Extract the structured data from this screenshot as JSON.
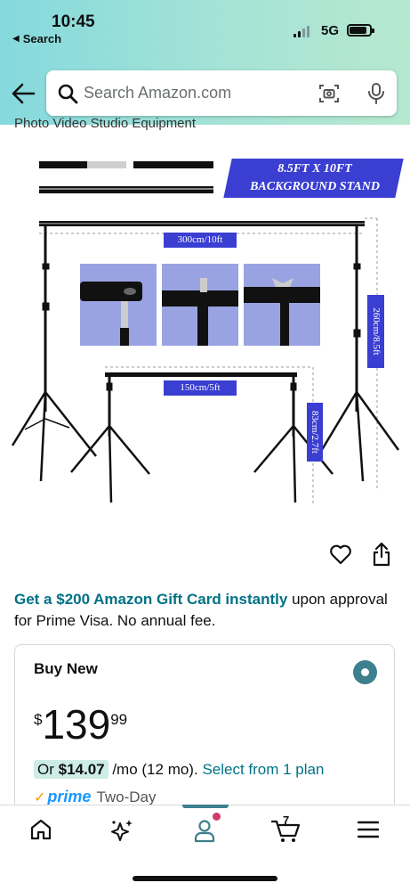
{
  "status_bar": {
    "time": "10:45",
    "back_app": "Search",
    "network": "5G"
  },
  "search": {
    "placeholder": "Search Amazon.com"
  },
  "partial_title": "Photo Video Studio Equipment",
  "product_image": {
    "banner_line1": "8.5FT X 10FT",
    "banner_line2": "BACKGROUND STAND",
    "dim_width_large": "300cm/10ft",
    "dim_width_small": "150cm/5ft",
    "dim_height_large": "260cm/8.5ft",
    "dim_height_small": "83cm/2.7ft"
  },
  "promo": {
    "highlight": "Get a $200 Amazon Gift Card instantly",
    "rest": " upon approval for Prime Visa. No annual fee."
  },
  "buy_box": {
    "title": "Buy New",
    "price_currency": "$",
    "price_whole": "139",
    "price_fraction": "99",
    "monthly_prefix": "Or ",
    "monthly_amount": "$14.07",
    "monthly_suffix": " /mo (12 mo).",
    "plan_link": "Select from 1 plan",
    "prime_check": "✓",
    "prime_label": "prime",
    "delivery": "Two-Day"
  },
  "bottom_nav": {
    "cart_count": "7"
  },
  "colors": {
    "header_gradient_start": "#85d9dd",
    "header_gradient_end": "#b6e8cf",
    "link": "#007185",
    "accent_blue_label": "#3a3ed1",
    "radio": "#3c7f8d",
    "prime_blue": "#1a98ff",
    "prime_check": "#ff9900",
    "notification_dot": "#d13a6b"
  }
}
